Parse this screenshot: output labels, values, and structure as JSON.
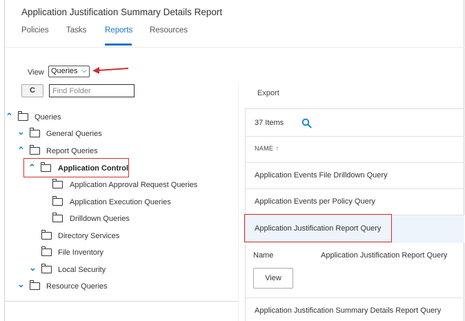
{
  "header": {
    "title": "Application Justification Summary Details Report"
  },
  "tabs": [
    {
      "label": "Policies"
    },
    {
      "label": "Tasks"
    },
    {
      "label": "Reports",
      "active": true
    },
    {
      "label": "Resources"
    }
  ],
  "view": {
    "label": "View",
    "selected": "Queries"
  },
  "toolbar": {
    "refresh_icon": "refresh-icon",
    "refresh_glyph": "C",
    "find_placeholder": "Find Folder"
  },
  "tree": {
    "root": "Queries",
    "general": "General Queries",
    "report": "Report Queries",
    "app_control": "Application Control",
    "approval": "Application Approval Request Queries",
    "execution": "Application Execution Queries",
    "drilldown": "Drilldown Queries",
    "directory": "Directory Services",
    "inventory": "File Inventory",
    "local_security": "Local Security",
    "resource": "Resource Queries"
  },
  "right": {
    "export": "Export",
    "count": "37 Items",
    "column_name": "NAME",
    "rows": [
      "Application Events File Drilldown Query",
      "Application Events per Policy Query",
      "Application Justification Report Query",
      "Application Justification Summary Details Report Query"
    ],
    "detail": {
      "label": "Name",
      "value": "Application Justification Report Query",
      "view_button": "View"
    }
  },
  "colors": {
    "accent": "#1a73c8",
    "highlight": "#d32f2f",
    "selected_row": "#eef4fb"
  }
}
